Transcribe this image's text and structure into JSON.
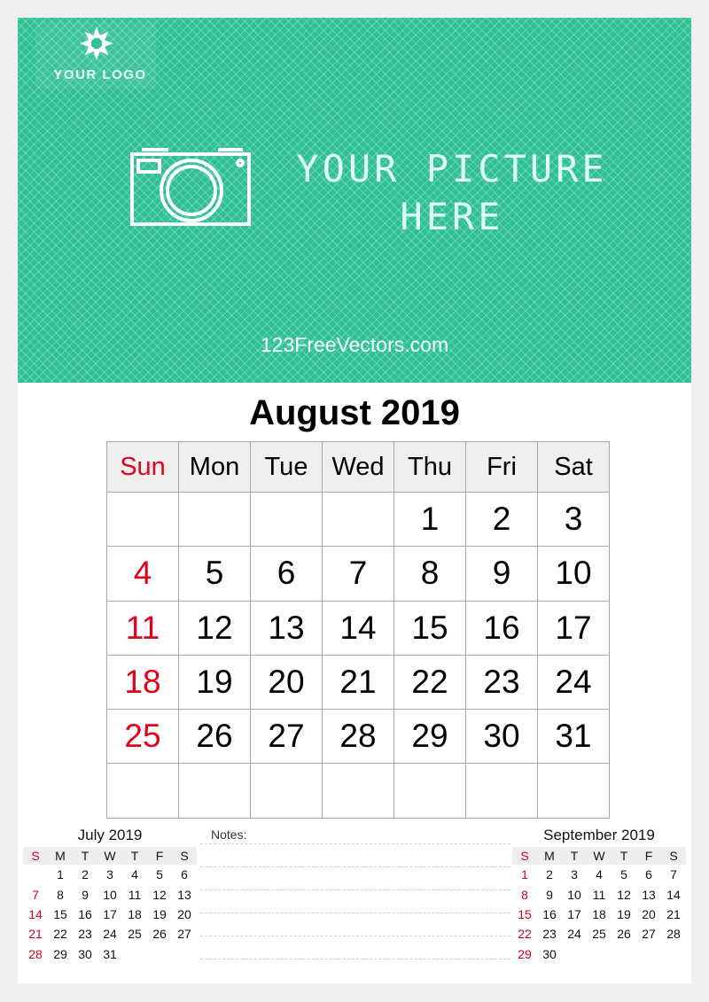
{
  "banner": {
    "logo_text": "YOUR LOGO",
    "picture_placeholder_line1": "YOUR PICTURE",
    "picture_placeholder_line2": "HERE",
    "site": "123FreeVectors.com",
    "colors": {
      "green": "#2fc095",
      "white": "#ffffff"
    },
    "icons": [
      "flower-logo-icon",
      "camera-icon"
    ]
  },
  "main_calendar": {
    "title": "August 2019",
    "weekdays": [
      "Sun",
      "Mon",
      "Tue",
      "Wed",
      "Thu",
      "Fri",
      "Sat"
    ],
    "weeks": [
      [
        "",
        "",
        "",
        "",
        "1",
        "2",
        "3"
      ],
      [
        "4",
        "5",
        "6",
        "7",
        "8",
        "9",
        "10"
      ],
      [
        "11",
        "12",
        "13",
        "14",
        "15",
        "16",
        "17"
      ],
      [
        "18",
        "19",
        "20",
        "21",
        "22",
        "23",
        "24"
      ],
      [
        "25",
        "26",
        "27",
        "28",
        "29",
        "30",
        "31"
      ],
      [
        "",
        "",
        "",
        "",
        "",
        "",
        ""
      ]
    ],
    "sunday_color": "#e3001b"
  },
  "prev_month": {
    "title": "July 2019",
    "weekdays": [
      "S",
      "M",
      "T",
      "W",
      "T",
      "F",
      "S"
    ],
    "weeks": [
      [
        "",
        "1",
        "2",
        "3",
        "4",
        "5",
        "6"
      ],
      [
        "7",
        "8",
        "9",
        "10",
        "11",
        "12",
        "13"
      ],
      [
        "14",
        "15",
        "16",
        "17",
        "18",
        "19",
        "20"
      ],
      [
        "21",
        "22",
        "23",
        "24",
        "25",
        "26",
        "27"
      ],
      [
        "28",
        "29",
        "30",
        "31",
        "",
        "",
        ""
      ]
    ]
  },
  "next_month": {
    "title": "September 2019",
    "weekdays": [
      "S",
      "M",
      "T",
      "W",
      "T",
      "F",
      "S"
    ],
    "weeks": [
      [
        "1",
        "2",
        "3",
        "4",
        "5",
        "6",
        "7"
      ],
      [
        "8",
        "9",
        "10",
        "11",
        "12",
        "13",
        "14"
      ],
      [
        "15",
        "16",
        "17",
        "18",
        "19",
        "20",
        "21"
      ],
      [
        "22",
        "23",
        "24",
        "25",
        "26",
        "27",
        "28"
      ],
      [
        "29",
        "30",
        "",
        "",
        "",
        "",
        ""
      ]
    ]
  },
  "notes": {
    "label": "Notes:",
    "line_count": 6
  }
}
